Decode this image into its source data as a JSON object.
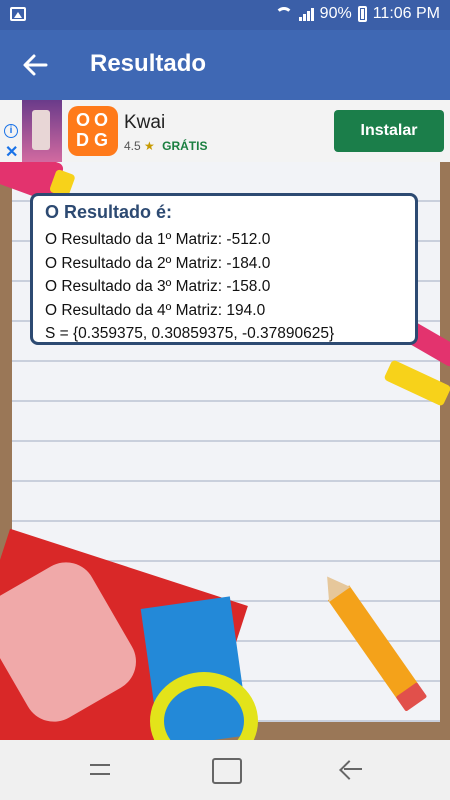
{
  "status_bar": {
    "battery_text": "90%",
    "time": "11:06 PM"
  },
  "app_bar": {
    "title": "Resultado"
  },
  "ad": {
    "info_glyph": "i",
    "close_glyph": "✕",
    "app_name": "Kwai",
    "rating": "4.5",
    "star": "★",
    "price": "GRÁTIS",
    "install_label": "Instalar"
  },
  "result": {
    "heading": "O Resultado é:",
    "lines": [
      "O Resultado da 1º Matriz: -512.0",
      "O Resultado da 2º Matriz: -184.0",
      "O Resultado da 3º Matriz: -158.0",
      "O Resultado da 4º Matriz: 194.0",
      "S = {0.359375, 0.30859375, -0.37890625}"
    ]
  },
  "colors": {
    "app_bar": "#3f68b4",
    "status_bar": "#3b5fa8",
    "install_button": "#1b7e4a",
    "card_border": "#2d4a72"
  }
}
